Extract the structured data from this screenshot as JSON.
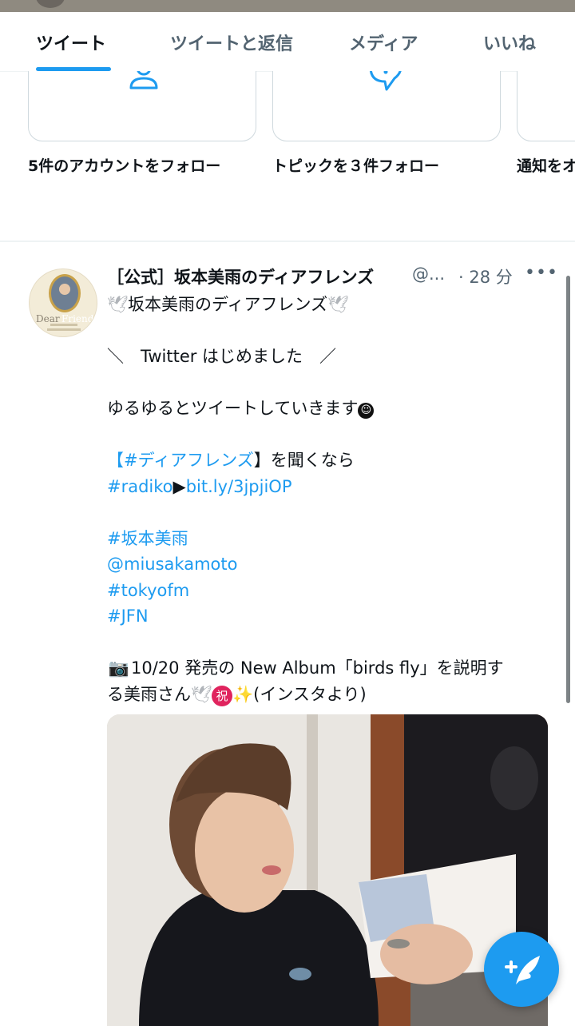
{
  "tabs": [
    {
      "label": "ツイート",
      "active": true
    },
    {
      "label": "ツイートと返信",
      "active": false
    },
    {
      "label": "メディア",
      "active": false
    },
    {
      "label": "いいね",
      "active": false
    }
  ],
  "suggestion_cards": [
    {
      "label": "5件のアカウントをフォロー",
      "icon": "person-icon"
    },
    {
      "label": "トピックを３件フォロー",
      "icon": "topic-bubble-icon"
    },
    {
      "label": "通知をオ",
      "icon": "notification-icon"
    }
  ],
  "tweet": {
    "name": "［公式］坂本美雨のディアフレンズ",
    "handle": "@...",
    "time": "· 28 分",
    "avatar_text": {
      "left": "Dear",
      "right": "Friends"
    },
    "line1_text": "坂本美雨のディアフレンズ",
    "line2_text": "＼　Twitter はじめました　／",
    "line3_text": "ゆるゆるとツイートしていきます",
    "line4_hashtag": "【#ディアフレンズ",
    "line4_rest": "】を聞くなら",
    "line5_hashtag": "#radiko",
    "line5_arrow": "▶",
    "line5_link": "bit.ly/3jpjiOP",
    "hashtag_sakamoto": "#坂本美雨",
    "mention": "@miusakamoto",
    "hashtag_tokyofm": "#tokyofm",
    "hashtag_jfn": "#JFN",
    "album_line1": "10/20 発売の New Album「birds fly」を説明す",
    "album_line2_a": "る美雨さん",
    "album_line2_b": "(インスタより)",
    "iwai_char": "祝"
  },
  "colors": {
    "accent": "#1d9bf0",
    "text": "#0f1419",
    "muted": "#536471"
  },
  "fab": {
    "icon": "compose-tweet-icon"
  }
}
